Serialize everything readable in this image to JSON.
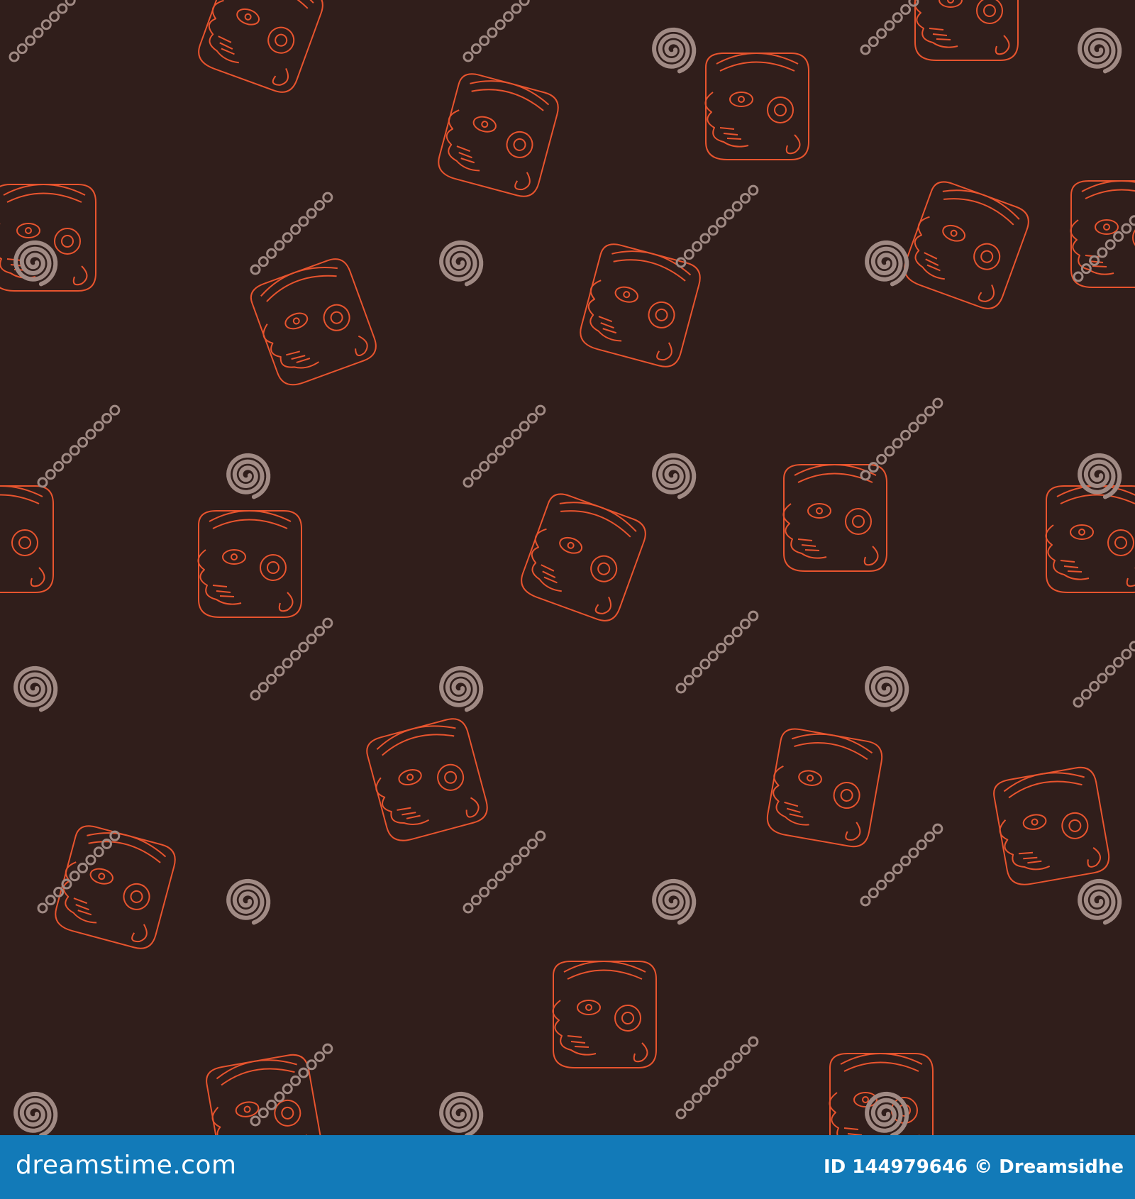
{
  "colors": {
    "background": "#301e1b",
    "glyph_stroke": "#e8542e",
    "watermark": "#a08a84",
    "footer": "#127ab8"
  },
  "pattern": {
    "subject": "Maya glyph heads",
    "watermark_icon": "spiral-logo-icon",
    "watermark_text": "dreamstime"
  },
  "footer": {
    "site": "dreamstime.com",
    "credit": "ID 144979646 © Dreamsidhe"
  }
}
